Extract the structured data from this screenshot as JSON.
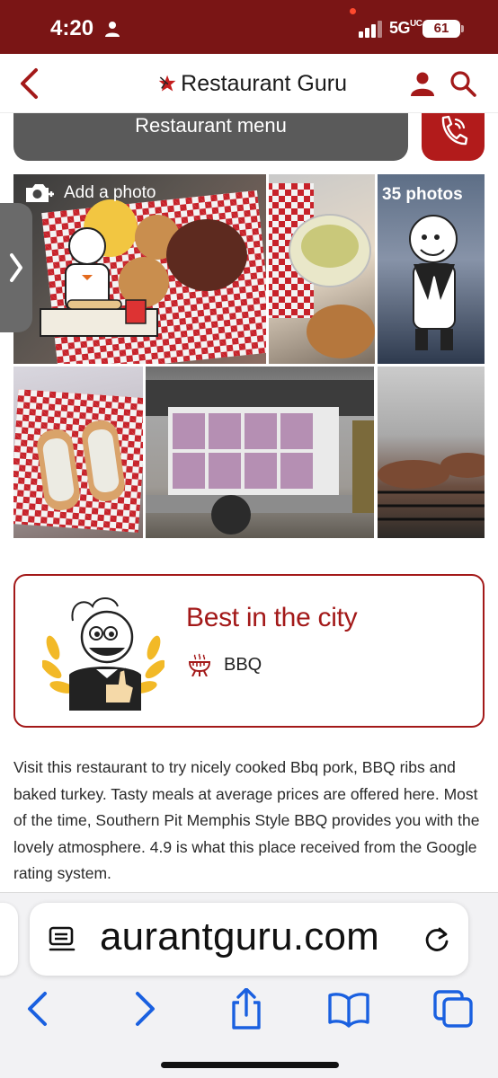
{
  "status_bar": {
    "time": "4:20",
    "network": "5G",
    "network_suffix": "UC",
    "battery": "61"
  },
  "header": {
    "title": "Restaurant Guru"
  },
  "actions": {
    "menu_label": "Restaurant menu"
  },
  "gallery": {
    "add_photo_label": "Add a photo",
    "photos_count": "35 photos"
  },
  "award": {
    "title": "Best in the city",
    "cuisine": "BBQ"
  },
  "description": "Visit this restaurant to try nicely cooked Bbq pork, BBQ ribs and baked turkey. Tasty meals at average prices are offered here. Most of the time, Southern Pit Memphis Style BBQ provides you with the lovely atmosphere. 4.9 is what this place received from the Google rating system.",
  "browser": {
    "url": "aurantguru.com"
  },
  "colors": {
    "brand": "#7a1515",
    "accent": "#a31919",
    "ios_blue": "#1a60e0"
  }
}
